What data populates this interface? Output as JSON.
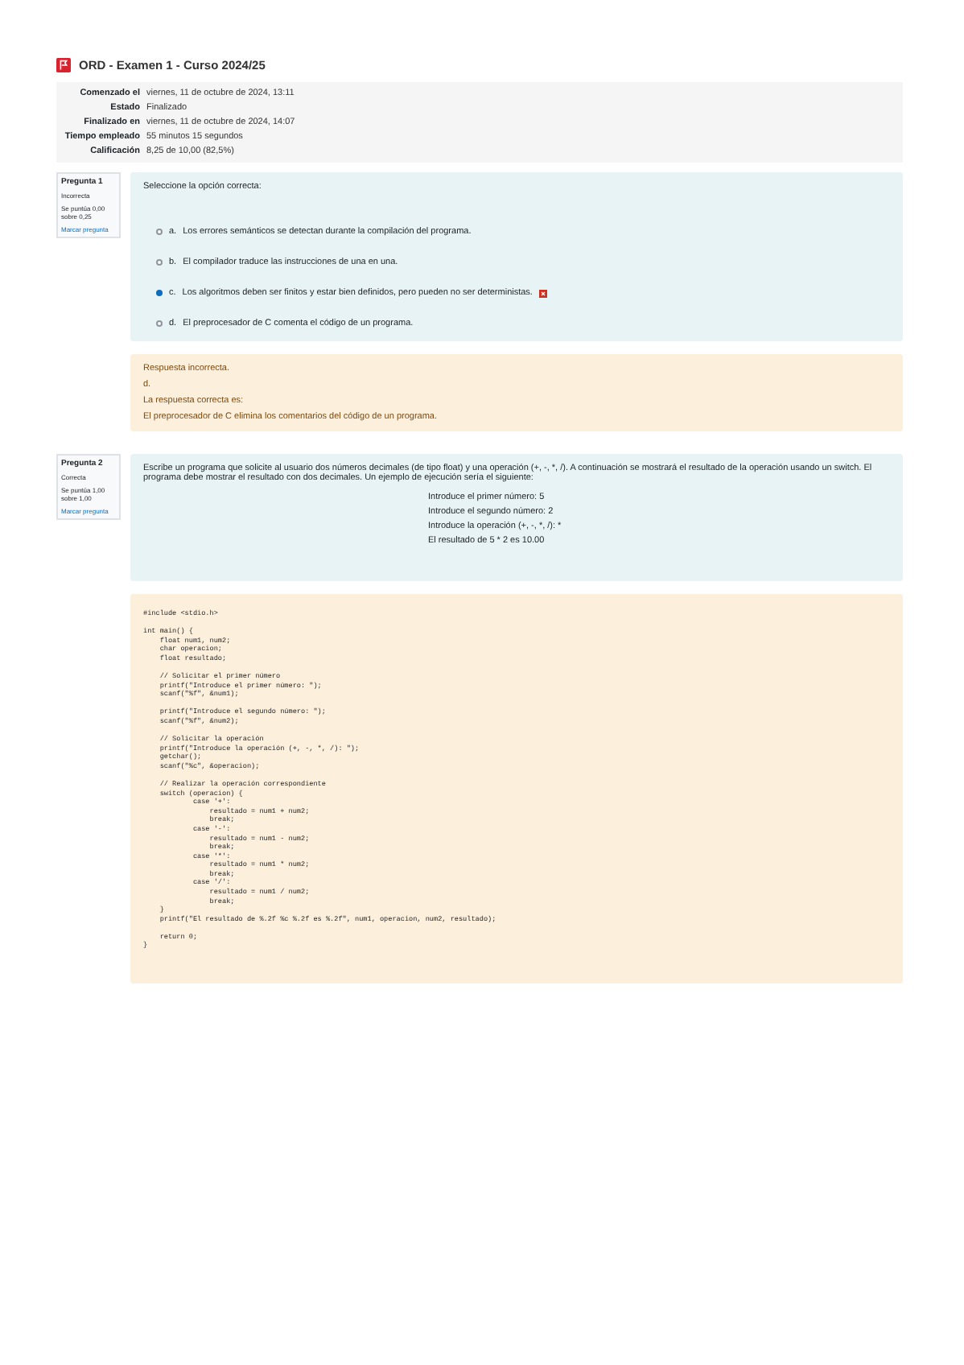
{
  "title": "ORD - Examen 1 - Curso 2024/25",
  "summary": [
    {
      "label": "Comenzado el",
      "value": "viernes, 11 de octubre de 2024, 13:11"
    },
    {
      "label": "Estado",
      "value": "Finalizado"
    },
    {
      "label": "Finalizado en",
      "value": "viernes, 11 de octubre de 2024, 14:07"
    },
    {
      "label": "Tiempo empleado",
      "value": "55 minutos 15 segundos"
    },
    {
      "label": "Calificación",
      "value": "8,25 de 10,00 (82,5%)"
    }
  ],
  "questions": [
    {
      "kind": "choice",
      "number": "Pregunta 1",
      "status": "Incorrecta",
      "score": "Se puntúa 0,00 sobre 0,25",
      "flag": "Marcar pregunta",
      "prompt": "Seleccione la opción correcta:",
      "options": [
        {
          "letter": "a.",
          "text": "Los errores semánticos se detectan durante la compilación del programa.",
          "selected": false,
          "wrong": false
        },
        {
          "letter": "b.",
          "text": "El compilador traduce las instrucciones de una en una.",
          "selected": false,
          "wrong": false
        },
        {
          "letter": "c.",
          "text": "Los algoritmos deben ser finitos y estar bien definidos, pero pueden no ser deterministas.",
          "selected": true,
          "wrong": true
        },
        {
          "letter": "d.",
          "text": "El preprocesador de C comenta el código de un programa.",
          "selected": false,
          "wrong": false
        }
      ],
      "feedback": [
        "Respuesta incorrecta.",
        "d.",
        "La respuesta correcta es:",
        "El preprocesador de C elimina los comentarios del código de un programa."
      ]
    },
    {
      "kind": "code",
      "number": "Pregunta 2",
      "status": "Correcta",
      "score": "Se puntúa 1,00 sobre 1,00",
      "flag": "Marcar pregunta",
      "prompt": "Escribe un programa que solicite al usuario dos números decimales (de tipo float) y una operación (+, -, *, /). A continuación se mostrará el resultado de la operación usando un switch. El programa debe mostrar el resultado con dos decimales. Un ejemplo de ejecución sería el siguiente:",
      "example": [
        "Introduce el primer número: 5",
        "Introduce el segundo número: 2",
        "Introduce la operación (+, -, *, /): *",
        "El resultado de 5 * 2 es 10.00"
      ],
      "code_blocks": [
        "#include <stdio.h>",
        "int main() {\n    float num1, num2;\n    char operacion;\n    float resultado;",
        "    // Solicitar el primer número\n    printf(\"Introduce el primer número: \");\n    scanf(\"%f\", &num1);",
        "    printf(\"Introduce el segundo número: \");\n    scanf(\"%f\", &num2);",
        "    // Solicitar la operación\n    printf(\"Introduce la operación (+, -, *, /): \");\n    getchar();\n    scanf(\"%c\", &operacion);",
        "    // Realizar la operación correspondiente\n    switch (operacion) {\n            case '+':\n                resultado = num1 + num2;\n                break;\n            case '-':\n                resultado = num1 - num2;\n                break;\n            case '*':\n                resultado = num1 * num2;\n                break;\n            case '/':\n                resultado = num1 / num2;\n                break;\n    }\n    printf(\"El resultado de %.2f %c %.2f es %.2f\", num1, operacion, num2, resultado);",
        "    return 0;\n}"
      ]
    }
  ]
}
